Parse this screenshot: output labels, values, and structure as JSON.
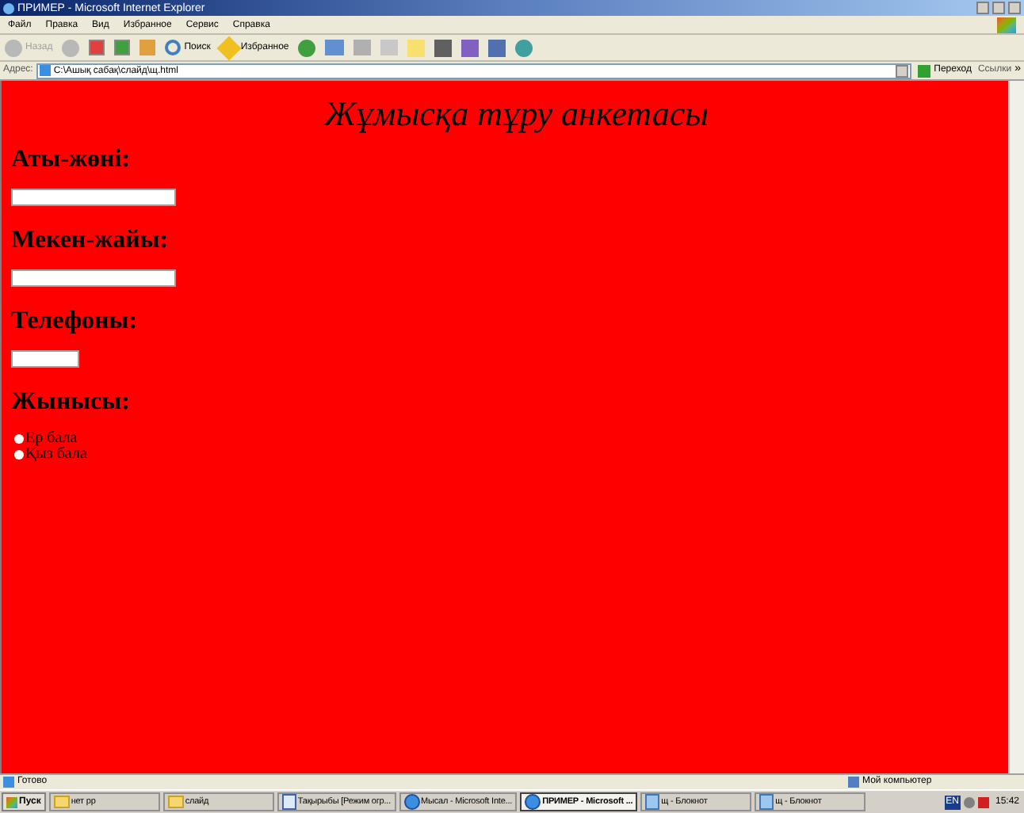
{
  "window": {
    "title": "ПРИМЕР - Microsoft Internet Explorer"
  },
  "menu": [
    "Файл",
    "Правка",
    "Вид",
    "Избранное",
    "Сервис",
    "Справка"
  ],
  "toolbar": {
    "back": {
      "label": "Назад",
      "disabled": true
    },
    "search": "Поиск",
    "favorites": "Избранное"
  },
  "address_bar": {
    "label": "Адрес:",
    "value": "C:\\Ашық сабақ\\слайд\\щ.html",
    "go": "Переход",
    "links": "Ссылки",
    "more": "»"
  },
  "page": {
    "title": "Жұмысқа тұру анкетасы",
    "fields": [
      {
        "label": "Аты-жөні:"
      },
      {
        "label": "Мекен-жайы:"
      },
      {
        "label": "Телефоны:"
      }
    ],
    "gender_label": "Жынысы:",
    "options": [
      {
        "label": "Ер бала",
        "selected": false
      },
      {
        "label": "Қыз бала",
        "selected": false
      }
    ]
  },
  "status_bar": {
    "text": "Готово",
    "zone": "Мой компьютер"
  },
  "taskbar": {
    "start": "Пуск",
    "items": [
      {
        "label": "нет рр",
        "kind": "folder",
        "selected": false
      },
      {
        "label": "слайд",
        "kind": "folder",
        "selected": false
      },
      {
        "label": "Тақырыбы [Режим огр...",
        "kind": "doc",
        "selected": false
      },
      {
        "label": "Мысал - Microsoft Inte...",
        "kind": "ie",
        "selected": false
      },
      {
        "label": "ПРИМЕР - Microsoft ...",
        "kind": "ie",
        "selected": true
      },
      {
        "label": "щ - Блокнот",
        "kind": "notepad",
        "selected": false
      },
      {
        "label": "щ - Блокнот",
        "kind": "notepad",
        "selected": false
      }
    ],
    "lang": "EN",
    "time": "15:42"
  }
}
